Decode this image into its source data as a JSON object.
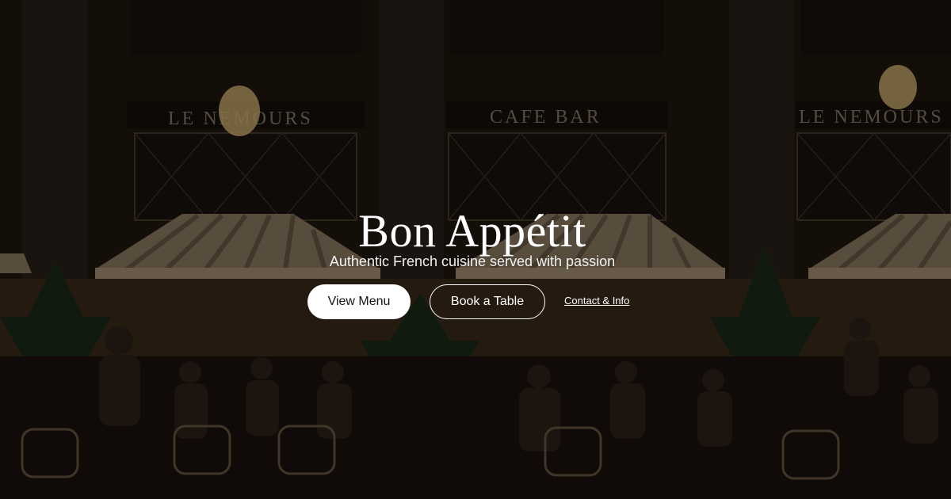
{
  "hero": {
    "title": "Bon Appétit",
    "subtitle": "Authentic French cuisine served with passion",
    "background_sign_left": "LE NEMOURS",
    "background_sign_center": "CAFE BAR",
    "background_sign_right": "LE NEMOURS"
  },
  "actions": {
    "view_menu": "View Menu",
    "book_table": "Book a Table",
    "contact_info": "Contact & Info"
  },
  "colors": {
    "primary_button_bg": "#ffffff",
    "primary_button_text": "#151515",
    "text": "#ffffff"
  }
}
